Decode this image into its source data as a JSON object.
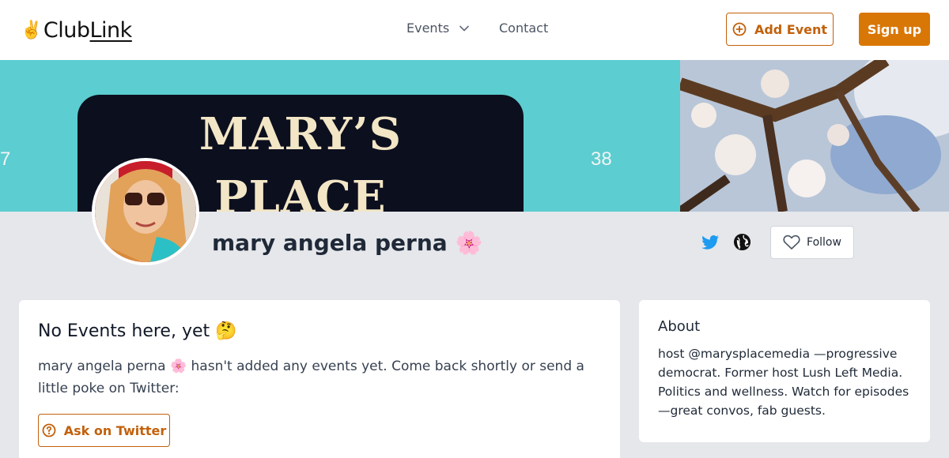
{
  "header": {
    "logo_part1": "Club",
    "logo_part2": "Link",
    "logo_emoji": "✌️",
    "nav_events": "Events",
    "nav_contact": "Contact",
    "add_event_label": "Add Event",
    "signup_label": "Sign up"
  },
  "banner": {
    "sign_line1": "MARY’S",
    "sign_line2": "PLACE",
    "num_left": "7",
    "num_right": "38"
  },
  "profile": {
    "name": "mary angela perna",
    "name_emoji": "🌸",
    "follow_label": "Follow"
  },
  "events": {
    "title": "No Events here, yet",
    "title_emoji": "🤔",
    "message": "mary angela perna 🌸 hasn't added any events yet. Come back shortly or send a little poke on Twitter:",
    "ask_label": "Ask on Twitter"
  },
  "about": {
    "title": "About",
    "text": "host @marysplacemedia —progressive democrat. Former host Lush Left Media. Politics and wellness. Watch for episodes—great convos, fab guests."
  },
  "colors": {
    "accent": "#d97706",
    "accent_border": "#c2610c",
    "twitter": "#1d9bf0",
    "page_bg": "#e5e7eb"
  },
  "icons": [
    "chevron-down-icon",
    "plus-circle-icon",
    "twitter-icon",
    "globe-icon",
    "heart-icon",
    "question-circle-icon"
  ]
}
